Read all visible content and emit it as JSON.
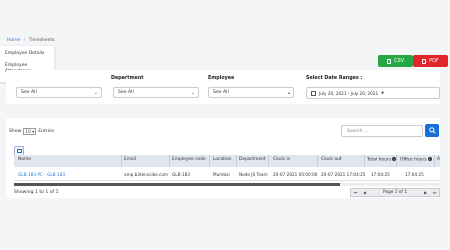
{
  "breadcrumb": {
    "home": "Home",
    "separator": "/",
    "current": "Timesheets"
  },
  "menu": {
    "items": [
      "Employee Details",
      "Employee Attendance"
    ]
  },
  "export": {
    "csv": "CSV",
    "pdf": "PDF"
  },
  "filters": {
    "labels": [
      "",
      "Department",
      "Employee",
      "Select Date Ranges :"
    ],
    "selects": [
      "See All",
      "See All",
      "See All"
    ],
    "date_range": "July 20, 2021 - July 20, 2021"
  },
  "table_controls": {
    "show_prefix": "Show",
    "entries_value": "10",
    "show_suffix": "Entries",
    "search_placeholder": "Search ..."
  },
  "table": {
    "headers": [
      "Name",
      "Email",
      "Employee code",
      "Location",
      "Department",
      "Clock in",
      "Clock out",
      "Total hours",
      "Office hours",
      "A"
    ],
    "rows": [
      [
        "GLB-183-PC - GLB-183",
        "amp.b3tenscibe.com",
        "GLB-183",
        "Mumbai",
        "Node JS Team",
        "20-07-2021 00:00:00",
        "20-07-2021 17:04:25",
        "17:04:25",
        "17:04:25",
        ""
      ]
    ]
  },
  "footer": {
    "showing": "Showing 1 to 1 of 1",
    "page_label": "Page 1 of 1"
  },
  "colors": {
    "primary": "#1a6fd6",
    "csv": "#28a745",
    "pdf": "#e0262a",
    "link": "#2a7ad4"
  }
}
